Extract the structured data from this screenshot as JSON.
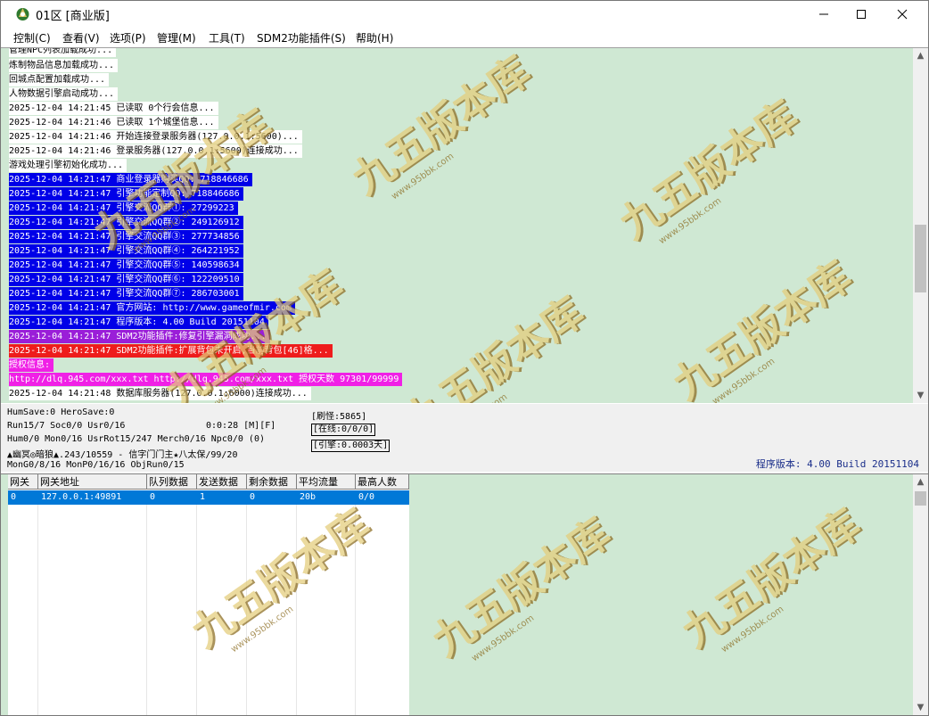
{
  "window": {
    "title": "01区 [商业版]",
    "controls": [
      "minimize",
      "maximize",
      "close"
    ]
  },
  "menu": [
    "控制(C)",
    "查看(V)",
    "选项(P)",
    "管理(M)",
    "工具(T)",
    "SDM2功能插件(S)",
    "帮助(H)"
  ],
  "log": [
    {
      "text": "管理NPC列表加载成功...",
      "style": "w"
    },
    {
      "text": "炼制物品信息加载成功...",
      "style": "w"
    },
    {
      "text": "回城点配置加载成功...",
      "style": "w"
    },
    {
      "text": "人物数据引擎启动成功...",
      "style": "w"
    },
    {
      "text": "2025-12-04 14:21:45 已读取 0个行会信息...",
      "style": "w"
    },
    {
      "text": "2025-12-04 14:21:46 已读取 1个城堡信息...",
      "style": "w"
    },
    {
      "text": "2025-12-04 14:21:46 开始连接登录服务器(127.0.0.1:5600)...",
      "style": "w"
    },
    {
      "text": "2025-12-04 14:21:46 登录服务器(127.0.0.1:5600)连接成功...",
      "style": "w"
    },
    {
      "text": "游戏处理引擎初始化成功...",
      "style": "w"
    },
    {
      "text": "2025-12-04 14:21:47 商业登录器购买QQ: 718846686",
      "style": "b"
    },
    {
      "text": "2025-12-04 14:21:47 引擎功能定制QQ: 718846686",
      "style": "b"
    },
    {
      "text": "2025-12-04 14:21:47 引擎交流QQ群①: 27299223",
      "style": "b"
    },
    {
      "text": "2025-12-04 14:21:47 引擎交流QQ群②: 249126912",
      "style": "b"
    },
    {
      "text": "2025-12-04 14:21:47 引擎交流QQ群③: 277734856",
      "style": "b"
    },
    {
      "text": "2025-12-04 14:21:47 引擎交流QQ群④: 264221952",
      "style": "b"
    },
    {
      "text": "2025-12-04 14:21:47 引擎交流QQ群⑤: 140598634",
      "style": "b"
    },
    {
      "text": "2025-12-04 14:21:47 引擎交流QQ群⑥: 122209510",
      "style": "b"
    },
    {
      "text": "2025-12-04 14:21:47 引擎交流QQ群⑦: 286703001",
      "style": "b"
    },
    {
      "text": "2025-12-04 14:21:47 官方网站: http://www.gameofmir.com",
      "style": "b"
    },
    {
      "text": "2025-12-04 14:21:47 程序版本: 4.00 Build 20151104",
      "style": "b"
    },
    {
      "text": "2025-12-04 14:21:47 SDM2功能插件:修复引擎漏洞成功...",
      "style": "p"
    },
    {
      "text": "2025-12-04 14:21:47 SDM2功能插件:扩展背包未开启,当前背包[46]格...",
      "style": "r"
    },
    {
      "text": "授权信息:",
      "style": "m"
    },
    {
      "text": "http://dlq.945.com/xxx.txt http://dlq.945.com/xxx.txt 授权天数 97301/99999",
      "style": "m"
    },
    {
      "text": "2025-12-04 14:21:48 数据库服务器(127.0.0.1:6000)连接成功...",
      "style": "w"
    }
  ],
  "status": {
    "line1": "HumSave:0 HeroSave:0",
    "line2": "Run15/7 Soc0/0 Usr0/16",
    "line2_time": "0:0:28 [M][F]",
    "line3": "Hum0/0 Mon0/16 UsrRot15/247 Merch0/16 Npc0/0 (0)",
    "line4": "▲幽冥◎暗狼▲.243/10559 - 信字门门主★八太保/99/20",
    "line5": "MonG0/8/16 MonP0/16/16 ObjRun0/15",
    "refresh": "[刷怪:5865]",
    "online": "[在线:0/0/0]",
    "engine": "[引擎:0.0003天]",
    "version": "程序版本: 4.00 Build 20151104"
  },
  "grid": {
    "headers": [
      "网关",
      "网关地址",
      "队列数据",
      "发送数据",
      "剩余数据",
      "平均流量",
      "最高人数"
    ],
    "rows": [
      [
        "0",
        "127.0.0.1:49891",
        "0",
        "1",
        "0",
        "20b",
        "0/0"
      ]
    ]
  },
  "watermark": {
    "text": "九五版本库",
    "url": "www.95bbk.com"
  }
}
